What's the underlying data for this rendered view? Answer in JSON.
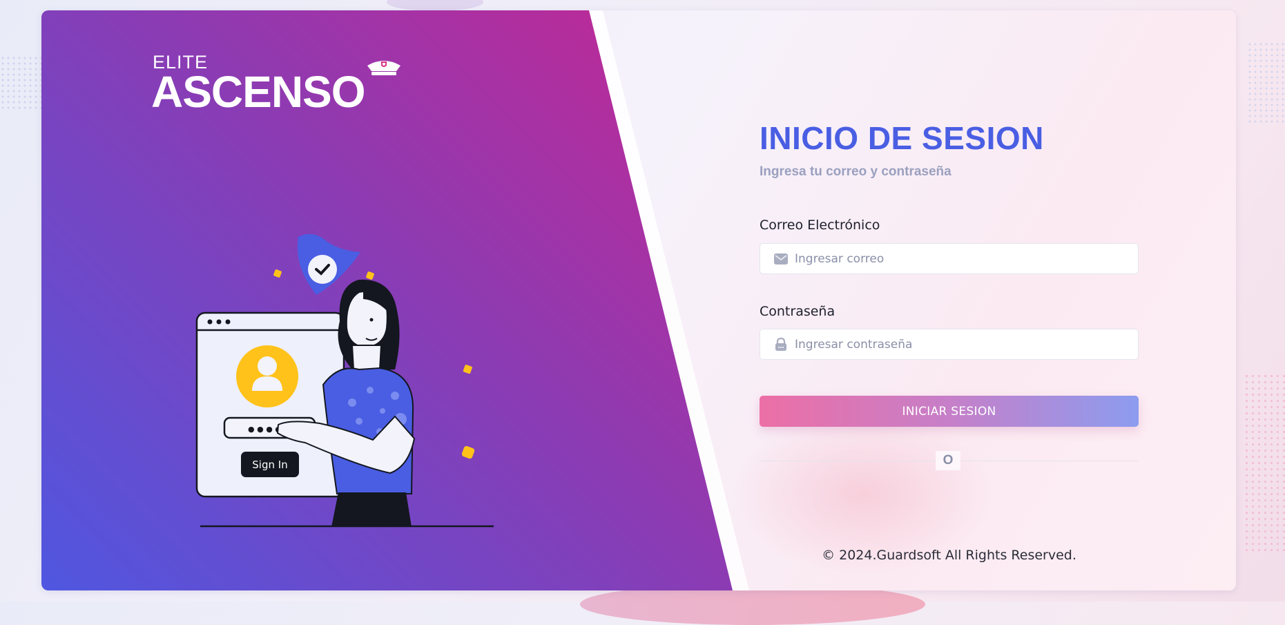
{
  "brand": {
    "small": "ELITE",
    "big": "ASCENSO"
  },
  "illustration": {
    "signin_label": "Sign In",
    "password_mask": "● ● ● ● ●"
  },
  "login": {
    "title": "INICIO DE SESION",
    "subtitle": "Ingresa tu correo y contraseña",
    "email_label": "Correo Electrónico",
    "email_placeholder": "Ingresar correo",
    "email_icon": "envelope-icon",
    "password_label": "Contraseña",
    "password_placeholder": "Ingresar contraseña",
    "password_icon": "lock-icon",
    "submit_label": "INICIAR SESION",
    "divider_text": "O"
  },
  "footer": {
    "copyright": "© 2024.Guardsoft All Rights Reserved."
  },
  "colors": {
    "title": "#4a5ee3",
    "hero_start": "#f01a5c",
    "hero_end": "#4f57e0",
    "button_start": "#ec6fa6",
    "button_end": "#8c9cef"
  }
}
